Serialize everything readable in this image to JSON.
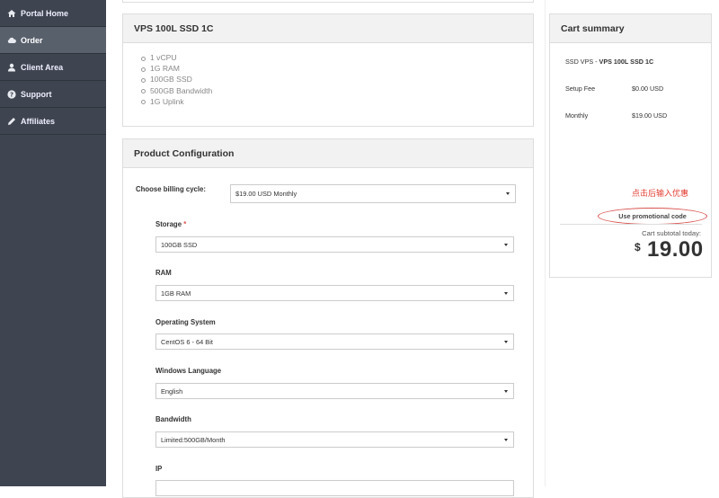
{
  "sidebar": {
    "items": [
      {
        "label": "Portal Home"
      },
      {
        "label": "Order"
      },
      {
        "label": "Client Area"
      },
      {
        "label": "Support"
      },
      {
        "label": "Affiliates"
      }
    ]
  },
  "product": {
    "title": "VPS 100L SSD 1C",
    "features": [
      "1 vCPU",
      "1G RAM",
      "100GB SSD",
      "500GB Bandwidth",
      "1G Uplink"
    ]
  },
  "config": {
    "title": "Product Configuration",
    "billing_label": "Choose billing cycle:",
    "billing_value": "$19.00 USD Monthly",
    "storage_label": "Storage",
    "required_mark": "*",
    "storage_value": "100GB SSD",
    "ram_label": "RAM",
    "ram_value": "1GB RAM",
    "os_label": "Operating System",
    "os_value": "CentOS 6 - 64 Bit",
    "lang_label": "Windows Language",
    "lang_value": "English",
    "bw_label": "Bandwidth",
    "bw_value": "Limited:500GB/Month",
    "ip_label": "IP",
    "ip_value": ""
  },
  "cart": {
    "title": "Cart summary",
    "product_prefix": "SSD VPS - ",
    "product_name": "VPS 100L SSD 1C",
    "setup_label": "Setup Fee",
    "setup_value": "$0.00 USD",
    "monthly_label": "Monthly",
    "monthly_value": "$19.00 USD",
    "promo_label": "Use promotional code",
    "annotation": "点击后输入优惠",
    "subtotal_label": "Cart subtotal today:",
    "currency_symbol": "$",
    "total": "19.00"
  },
  "colors": {
    "sidebar_bg": "#3f4550",
    "sidebar_active": "#58606c",
    "annotation_red": "#e23b30"
  }
}
